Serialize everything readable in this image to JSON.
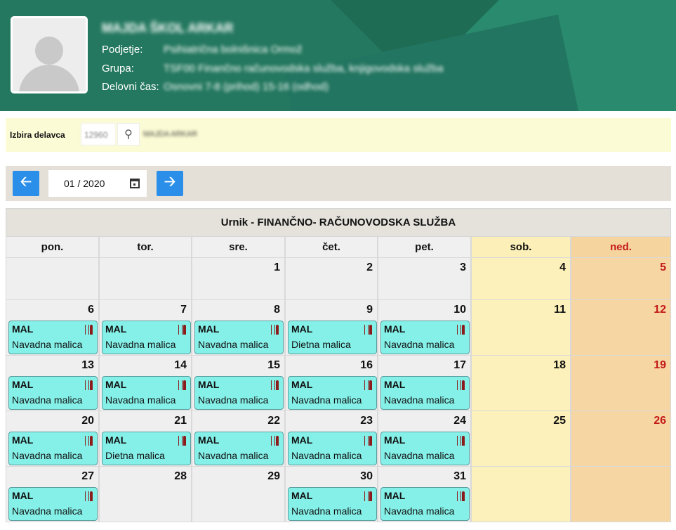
{
  "header": {
    "name": "MAJDA ŠKOL ARKAR",
    "rows": [
      {
        "label": "Podjetje:",
        "value": "Psihiatrična bolnišnica Ormož"
      },
      {
        "label": "Grupa:",
        "value": "TSF00 Finančno računovodska služba, knjigovodska služba"
      },
      {
        "label": "Delovni čas:",
        "value": "Osnovni 7-8 (prihod) 15-16 (odhod)"
      }
    ]
  },
  "izbira": {
    "label": "Izbira delavca",
    "input_value": "12960",
    "selected": "MAJDA ARKAR"
  },
  "nav": {
    "month": "01 / 2020"
  },
  "calendar": {
    "title": "Urnik - FINANČNO- RAČUNOVODSKA SLUŽBA",
    "days": [
      "pon.",
      "tor.",
      "sre.",
      "čet.",
      "pet.",
      "sob.",
      "ned."
    ],
    "weeks": [
      [
        {
          "day": ""
        },
        {
          "day": ""
        },
        {
          "day": "1"
        },
        {
          "day": "2"
        },
        {
          "day": "3"
        },
        {
          "day": "4"
        },
        {
          "day": "5"
        }
      ],
      [
        {
          "day": "6",
          "code": "MAL",
          "desc": "Navadna malica"
        },
        {
          "day": "7",
          "code": "MAL",
          "desc": "Navadna malica"
        },
        {
          "day": "8",
          "code": "MAL",
          "desc": "Navadna malica"
        },
        {
          "day": "9",
          "code": "MAL",
          "desc": "Dietna malica"
        },
        {
          "day": "10",
          "code": "MAL",
          "desc": "Navadna malica"
        },
        {
          "day": "11"
        },
        {
          "day": "12"
        }
      ],
      [
        {
          "day": "13",
          "code": "MAL",
          "desc": "Navadna malica"
        },
        {
          "day": "14",
          "code": "MAL",
          "desc": "Navadna malica"
        },
        {
          "day": "15",
          "code": "MAL",
          "desc": "Navadna malica"
        },
        {
          "day": "16",
          "code": "MAL",
          "desc": "Navadna malica"
        },
        {
          "day": "17",
          "code": "MAL",
          "desc": "Navadna malica"
        },
        {
          "day": "18"
        },
        {
          "day": "19"
        }
      ],
      [
        {
          "day": "20",
          "code": "MAL",
          "desc": "Navadna malica"
        },
        {
          "day": "21",
          "code": "MAL",
          "desc": "Dietna malica"
        },
        {
          "day": "22",
          "code": "MAL",
          "desc": "Navadna malica"
        },
        {
          "day": "23",
          "code": "MAL",
          "desc": "Navadna malica"
        },
        {
          "day": "24",
          "code": "MAL",
          "desc": "Navadna malica"
        },
        {
          "day": "25"
        },
        {
          "day": "26"
        }
      ],
      [
        {
          "day": "27",
          "code": "MAL",
          "desc": "Navadna malica"
        },
        {
          "day": "28"
        },
        {
          "day": "29"
        },
        {
          "day": "30",
          "code": "MAL",
          "desc": "Navadna malica"
        },
        {
          "day": "31",
          "code": "MAL",
          "desc": "Navadna malica"
        },
        {
          "day": ""
        },
        {
          "day": ""
        }
      ]
    ]
  },
  "colors": {
    "header_bg": "#24785f",
    "event_bg": "#85f0e8",
    "nav_button": "#2b8ee9",
    "sunday_text": "#c41a1a",
    "saturday_bg": "#fcf1ba",
    "sunday_bg": "#f6d6a2"
  },
  "icons": {
    "prev": "arrow-left-icon",
    "next": "arrow-right-icon",
    "search": "search-icon",
    "calendar": "calendar-icon",
    "meal": "fork-knife-icon"
  }
}
